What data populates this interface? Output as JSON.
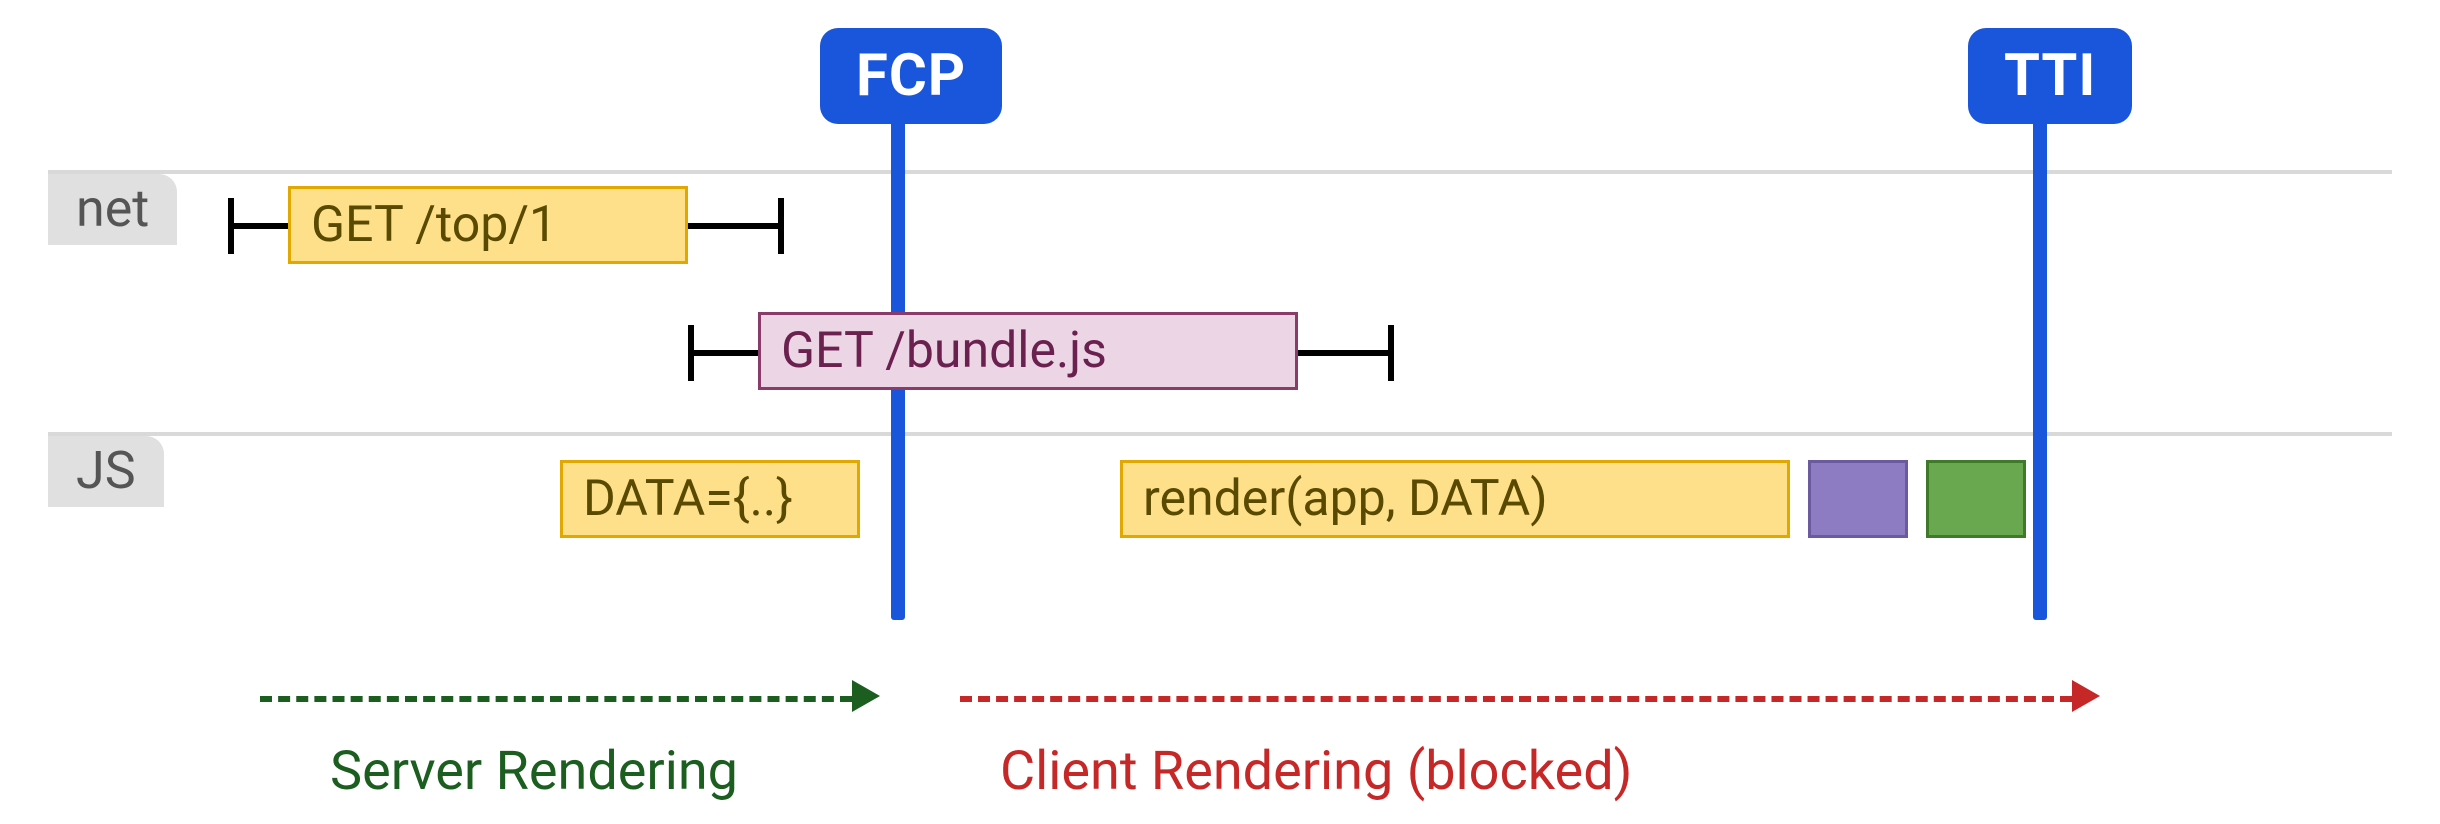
{
  "milestones": {
    "fcp": {
      "label": "FCP"
    },
    "tti": {
      "label": "TTI"
    }
  },
  "lanes": {
    "net": {
      "label": "net"
    },
    "js": {
      "label": "JS"
    }
  },
  "bars": {
    "get_top": {
      "label": "GET /top/1"
    },
    "get_bundle": {
      "label": "GET /bundle.js"
    },
    "data_block": {
      "label": "DATA={..}"
    },
    "render": {
      "label": "render(app, DATA)"
    }
  },
  "phases": {
    "server": {
      "label": "Server Rendering"
    },
    "client": {
      "label": "Client Rendering (blocked)"
    }
  },
  "colors": {
    "blue": "#1a56db",
    "yellow": "#ffe08a",
    "pink": "#ecd6e5",
    "purple": "#8e7cc3",
    "green_block": "#6aa84f",
    "green_arrow": "#1b5e20",
    "red_arrow": "#c62828",
    "lane_grey": "#e0e0e0"
  }
}
